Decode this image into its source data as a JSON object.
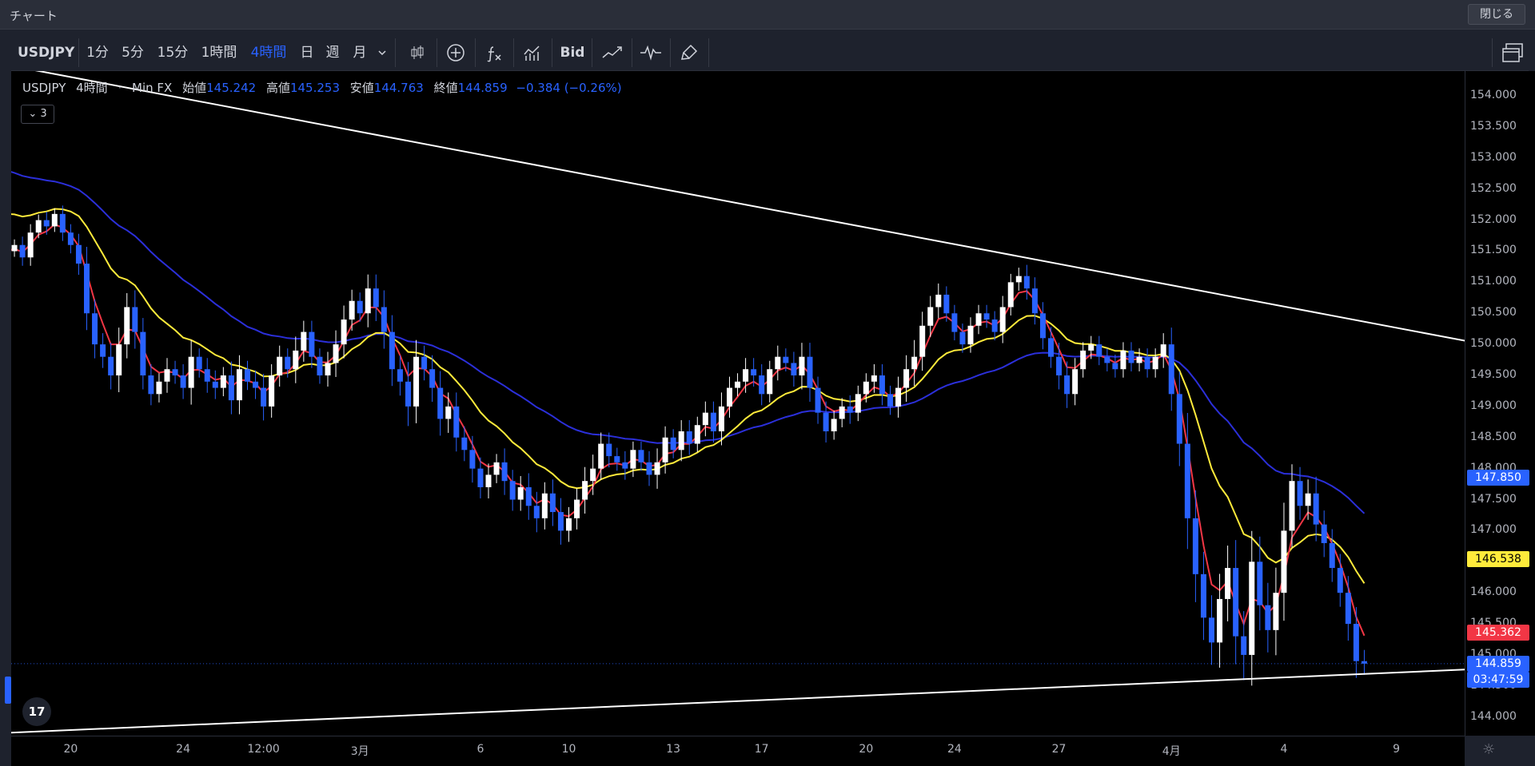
{
  "window": {
    "title": "チャート",
    "close_label": "閉じる"
  },
  "toolbar": {
    "symbol": "USDJPY",
    "intervals": [
      {
        "label": "1分",
        "selected": false
      },
      {
        "label": "5分",
        "selected": false
      },
      {
        "label": "15分",
        "selected": false
      },
      {
        "label": "1時間",
        "selected": false
      },
      {
        "label": "4時間",
        "selected": true
      },
      {
        "label": "日",
        "selected": false
      },
      {
        "label": "週",
        "selected": false
      },
      {
        "label": "月",
        "selected": false
      }
    ],
    "dropdown_icon": "chevron-down-icon",
    "bid_label": "Bid",
    "icons": [
      "candlestick-icon",
      "plus-circle-icon",
      "indicator-fx-icon",
      "bar-chart-icon",
      "line-compare-icon",
      "waveform-icon",
      "brush-icon",
      "layout-windows-icon"
    ]
  },
  "legend": {
    "symbol": "USDJPY",
    "interval": "4時間",
    "source": "Min FX",
    "open_label": "始値",
    "open": "145.242",
    "high_label": "高値",
    "high": "145.253",
    "low_label": "安値",
    "low": "144.763",
    "close_label": "終値",
    "close": "144.859",
    "change": "−0.384 (−0.26%)",
    "collapse_count": "3"
  },
  "price_axis": {
    "ticks": [
      "154.000",
      "153.500",
      "153.000",
      "152.500",
      "152.000",
      "151.500",
      "151.000",
      "150.500",
      "150.000",
      "149.500",
      "149.000",
      "148.500",
      "148.000",
      "147.500",
      "147.000",
      "146.500",
      "146.000",
      "145.500",
      "145.000",
      "144.500",
      "144.000"
    ],
    "tags": [
      {
        "value": "147.850",
        "bg": "#2962ff",
        "fg": "#ffffff"
      },
      {
        "value": "146.538",
        "bg": "#ffeb3b",
        "fg": "#000000"
      },
      {
        "value": "145.362",
        "bg": "#f23645",
        "fg": "#ffffff"
      },
      {
        "value": "144.859",
        "bg": "#2962ff",
        "fg": "#ffffff"
      }
    ],
    "countdown": "03:47:59",
    "settings_icon": "gear-icon"
  },
  "time_axis": {
    "labels": [
      {
        "text": "20",
        "index": 8
      },
      {
        "text": "24",
        "index": 22
      },
      {
        "text": "12:00",
        "index": 32
      },
      {
        "text": "3月",
        "index": 44
      },
      {
        "text": "6",
        "index": 59
      },
      {
        "text": "10",
        "index": 70
      },
      {
        "text": "13",
        "index": 83
      },
      {
        "text": "17",
        "index": 94
      },
      {
        "text": "20",
        "index": 107
      },
      {
        "text": "24",
        "index": 118
      },
      {
        "text": "27",
        "index": 131
      },
      {
        "text": "4月",
        "index": 145
      },
      {
        "text": "4",
        "index": 159
      },
      {
        "text": "9",
        "index": 173
      }
    ]
  },
  "logo_text": "17",
  "chart_data": {
    "type": "candlestick",
    "symbol": "USDJPY",
    "interval": "4時間",
    "ylim": [
      143.7,
      154.4
    ],
    "colors": {
      "up": "#ffffff",
      "down": "#2962ff",
      "ma_short": "#f23645",
      "ma_mid": "#ffeb3b",
      "ma_long": "#2b2fd9",
      "trendline": "#ffffff"
    },
    "close": [
      151.5,
      151.6,
      151.4,
      151.8,
      152.0,
      151.9,
      152.1,
      151.8,
      151.6,
      151.3,
      150.5,
      150.0,
      149.8,
      149.5,
      150.0,
      150.6,
      150.2,
      149.5,
      149.2,
      149.4,
      149.6,
      149.5,
      149.3,
      149.8,
      149.6,
      149.4,
      149.3,
      149.5,
      149.1,
      149.6,
      149.4,
      149.3,
      149.0,
      149.5,
      149.8,
      149.6,
      149.9,
      150.2,
      149.8,
      149.5,
      149.7,
      150.0,
      150.4,
      150.7,
      150.5,
      150.9,
      150.6,
      150.2,
      149.6,
      149.4,
      149.0,
      149.8,
      149.6,
      149.3,
      148.8,
      149.0,
      148.5,
      148.3,
      148.0,
      147.7,
      147.9,
      148.1,
      147.8,
      147.5,
      147.7,
      147.4,
      147.2,
      147.6,
      147.3,
      147.0,
      147.2,
      147.5,
      147.8,
      148.0,
      148.4,
      148.2,
      148.1,
      148.0,
      148.3,
      148.1,
      147.9,
      148.1,
      148.5,
      148.3,
      148.6,
      148.4,
      148.7,
      148.9,
      148.6,
      149.0,
      149.3,
      149.4,
      149.6,
      149.5,
      149.2,
      149.6,
      149.8,
      149.7,
      149.5,
      149.8,
      149.3,
      148.9,
      148.6,
      148.8,
      149.0,
      148.9,
      149.2,
      149.4,
      149.5,
      149.2,
      149.0,
      149.3,
      149.6,
      149.8,
      150.3,
      150.6,
      150.8,
      150.5,
      150.2,
      150.0,
      150.3,
      150.5,
      150.4,
      150.2,
      150.6,
      151.0,
      151.1,
      150.9,
      150.5,
      150.1,
      149.8,
      149.5,
      149.2,
      149.6,
      149.9,
      150.0,
      149.8,
      149.7,
      149.6,
      149.9,
      149.7,
      149.8,
      149.6,
      149.8,
      150.0,
      149.2,
      148.4,
      147.2,
      146.3,
      145.6,
      145.2,
      145.9,
      146.4,
      145.3,
      145.0,
      146.5,
      145.8,
      145.4,
      146.0,
      147.0,
      147.8,
      147.4,
      147.6,
      147.1,
      146.8,
      146.4,
      146.0,
      145.5,
      144.9,
      144.859
    ],
    "spans": [
      0.3,
      0.2,
      0.3,
      0.3,
      0.2,
      0.3,
      0.2,
      0.3,
      0.3,
      0.4,
      0.6,
      0.5,
      0.4,
      0.5,
      0.6,
      0.5,
      0.6,
      0.5,
      0.4,
      0.3,
      0.4,
      0.3,
      0.4,
      0.6,
      0.3,
      0.4,
      0.4,
      0.3,
      0.5,
      0.5,
      0.3,
      0.4,
      0.5,
      0.4,
      0.4,
      0.3,
      0.5,
      0.4,
      0.4,
      0.3,
      0.4,
      0.5,
      0.5,
      0.4,
      0.3,
      0.5,
      0.5,
      0.6,
      0.6,
      0.5,
      0.7,
      0.6,
      0.4,
      0.5,
      0.6,
      0.5,
      0.5,
      0.4,
      0.5,
      0.4,
      0.4,
      0.3,
      0.5,
      0.4,
      0.4,
      0.5,
      0.5,
      0.4,
      0.5,
      0.5,
      0.4,
      0.4,
      0.5,
      0.5,
      0.4,
      0.4,
      0.3,
      0.4,
      0.3,
      0.3,
      0.4,
      0.5,
      0.4,
      0.3,
      0.4,
      0.4,
      0.3,
      0.4,
      0.4,
      0.5,
      0.4,
      0.3,
      0.4,
      0.4,
      0.4,
      0.3,
      0.4,
      0.3,
      0.4,
      0.5,
      0.5,
      0.4,
      0.4,
      0.3,
      0.3,
      0.4,
      0.3,
      0.3,
      0.4,
      0.4,
      0.3,
      0.4,
      0.5,
      0.6,
      0.5,
      0.4,
      0.4,
      0.3,
      0.3,
      0.3,
      0.3,
      0.3,
      0.3,
      0.3,
      0.4,
      0.3,
      0.3,
      0.4,
      0.4,
      0.4,
      0.4,
      0.5,
      0.5,
      0.4,
      0.3,
      0.3,
      0.3,
      0.3,
      0.3,
      0.3,
      0.3,
      0.3,
      0.3,
      0.3,
      0.4,
      0.6,
      0.8,
      1.1,
      1.0,
      0.8,
      0.8,
      0.9,
      0.8,
      1.0,
      0.9,
      1.1,
      0.9,
      0.8,
      0.9,
      1.0,
      0.6,
      0.5,
      0.5,
      0.6,
      0.5,
      0.5,
      0.5,
      0.6,
      0.6,
      0.4
    ],
    "trendlines": [
      {
        "from": [
          0,
          154.5
        ],
        "to": [
          188,
          149.9
        ]
      },
      {
        "from": [
          -8,
          143.7
        ],
        "to": [
          188,
          144.8
        ]
      }
    ]
  }
}
